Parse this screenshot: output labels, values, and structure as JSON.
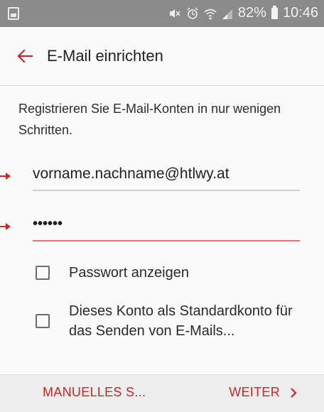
{
  "status_bar": {
    "battery_percent": "82%",
    "time": "10:46",
    "icons": [
      "notification-icon",
      "mute-icon",
      "alarm-icon",
      "wifi-icon",
      "signal-icon",
      "battery-icon"
    ]
  },
  "app_bar": {
    "title": "E-Mail einrichten",
    "back_icon": "arrow-left-icon"
  },
  "main": {
    "intro_text": "Registrieren Sie E-Mail-Konten in nur wenigen Schritten.",
    "email_value": "vorname.nachname@htlwy.at",
    "password_masked": "••••••",
    "show_password_label": "Passwort anzeigen",
    "default_account_label": "Dieses Konto als Standardkonto für das Senden von E-Mails..."
  },
  "bottom_bar": {
    "manual_label": "MANUELLES S...",
    "next_label": "WEITER",
    "next_icon": "chevron-right-icon"
  },
  "colors": {
    "accent": "#c62828",
    "status_bar": "#8a8a8a",
    "password_underline": "#e57373"
  }
}
